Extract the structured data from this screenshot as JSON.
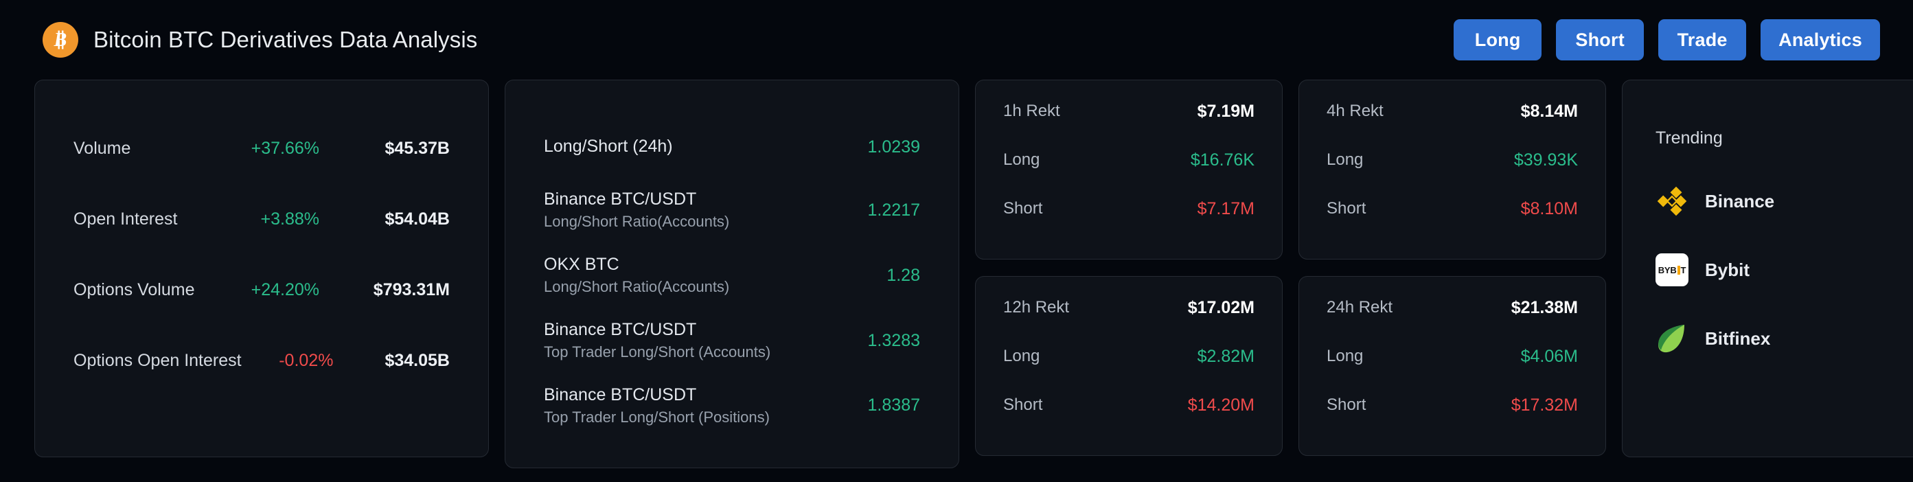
{
  "header": {
    "logo_icon": "bitcoin-icon",
    "title": "Bitcoin BTC Derivatives Data Analysis",
    "buttons": [
      {
        "label": "Long",
        "name": "long-button"
      },
      {
        "label": "Short",
        "name": "short-button"
      },
      {
        "label": "Trade",
        "name": "trade-button"
      },
      {
        "label": "Analytics",
        "name": "analytics-button"
      }
    ],
    "accent_color": "#2f6fd0"
  },
  "colors": {
    "positive": "#2bbd8c",
    "negative": "#f04b4b",
    "card_bg": "#0e1219",
    "page_bg": "#04070d",
    "bitcoin_orange": "#f1972c"
  },
  "metrics": [
    {
      "label": "Volume",
      "change": "+37.66%",
      "direction": "up",
      "value": "$45.37B"
    },
    {
      "label": "Open Interest",
      "change": "+3.88%",
      "direction": "up",
      "value": "$54.04B"
    },
    {
      "label": "Options Volume",
      "change": "+24.20%",
      "direction": "up",
      "value": "$793.31M"
    },
    {
      "label": "Options Open Interest",
      "change": "-0.02%",
      "direction": "down",
      "value": "$34.05B"
    }
  ],
  "ratios": [
    {
      "title": "Long/Short (24h)",
      "sub": "",
      "value": "1.0239"
    },
    {
      "title": "Binance BTC/USDT",
      "sub": "Long/Short Ratio(Accounts)",
      "value": "1.2217"
    },
    {
      "title": "OKX BTC",
      "sub": "Long/Short Ratio(Accounts)",
      "value": "1.28"
    },
    {
      "title": "Binance BTC/USDT",
      "sub": "Top Trader Long/Short (Accounts)",
      "value": "1.3283"
    },
    {
      "title": "Binance BTC/USDT",
      "sub": "Top Trader Long/Short (Positions)",
      "value": "1.8387"
    }
  ],
  "rekt": [
    {
      "period_label": "1h Rekt",
      "total": "$7.19M",
      "long_label": "Long",
      "long": "$16.76K",
      "short_label": "Short",
      "short": "$7.17M"
    },
    {
      "period_label": "4h Rekt",
      "total": "$8.14M",
      "long_label": "Long",
      "long": "$39.93K",
      "short_label": "Short",
      "short": "$8.10M"
    },
    {
      "period_label": "12h Rekt",
      "total": "$17.02M",
      "long_label": "Long",
      "long": "$2.82M",
      "short_label": "Short",
      "short": "$14.20M"
    },
    {
      "period_label": "24h Rekt",
      "total": "$21.38M",
      "long_label": "Long",
      "long": "$4.06M",
      "short_label": "Short",
      "short": "$17.32M"
    }
  ],
  "trending": {
    "title": "Trending",
    "items": [
      {
        "name": "Binance",
        "icon": "binance-logo-icon",
        "color": "#f0b90b"
      },
      {
        "name": "Bybit",
        "icon": "bybit-logo-icon",
        "color": "#f7a600"
      },
      {
        "name": "Bitfinex",
        "icon": "bitfinex-logo-icon",
        "color": "#62c352"
      }
    ]
  }
}
